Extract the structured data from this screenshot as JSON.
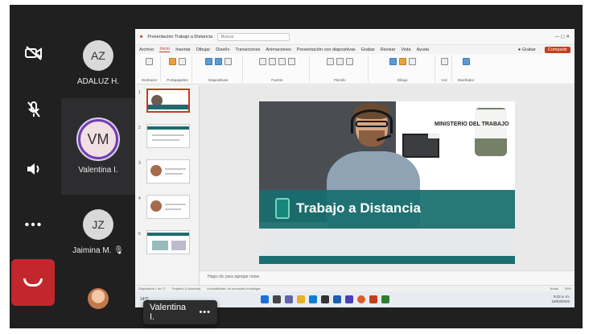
{
  "participants": [
    {
      "initials": "AZ",
      "name": "ADALUZ H."
    },
    {
      "initials": "VM",
      "name": "Valentina I."
    },
    {
      "initials": "JZ",
      "name": "Jaimina M."
    }
  ],
  "share": {
    "title_text": "Presentación Trabajo a Distancia",
    "search_placeholder": "Buscar",
    "tabs": [
      "Archivo",
      "Inicio",
      "Insertar",
      "Dibujar",
      "Diseño",
      "Transiciones",
      "Animaciones",
      "Presentación con diapositivas",
      "Grabar",
      "Revisar",
      "Vista",
      "Ayuda"
    ],
    "record_label": "● Grabar",
    "share_label": "Compartir",
    "ribbon_groups": [
      "Deshacer",
      "Portapapeles",
      "Diapositivas",
      "Fuente",
      "Párrafo",
      "Dibujo",
      "Voz",
      "Diseñador"
    ],
    "slide_numbers": [
      "1",
      "2",
      "3",
      "4",
      "5"
    ],
    "slide_title": "Trabajo a Distancia",
    "ministry": "MINISTERIO DEL TRABAJO",
    "notes_placeholder": "Haga clic para agregar notas",
    "status_left": "Diapositiva 1 de 17",
    "status_lang": "Español (Colombia)",
    "status_access": "Accesibilidad: es necesario investigar",
    "status_notes": "Notas",
    "zoom": "59%",
    "weather": "14°C",
    "clock_time": "9:22 a. m.",
    "clock_date": "23/03/2022"
  },
  "name_tag": {
    "name": "Valentina I.",
    "more": "•••"
  },
  "colors": {
    "hangup": "#c4262e",
    "teal": "#1f6c6f",
    "accent": "#c43e1c"
  }
}
